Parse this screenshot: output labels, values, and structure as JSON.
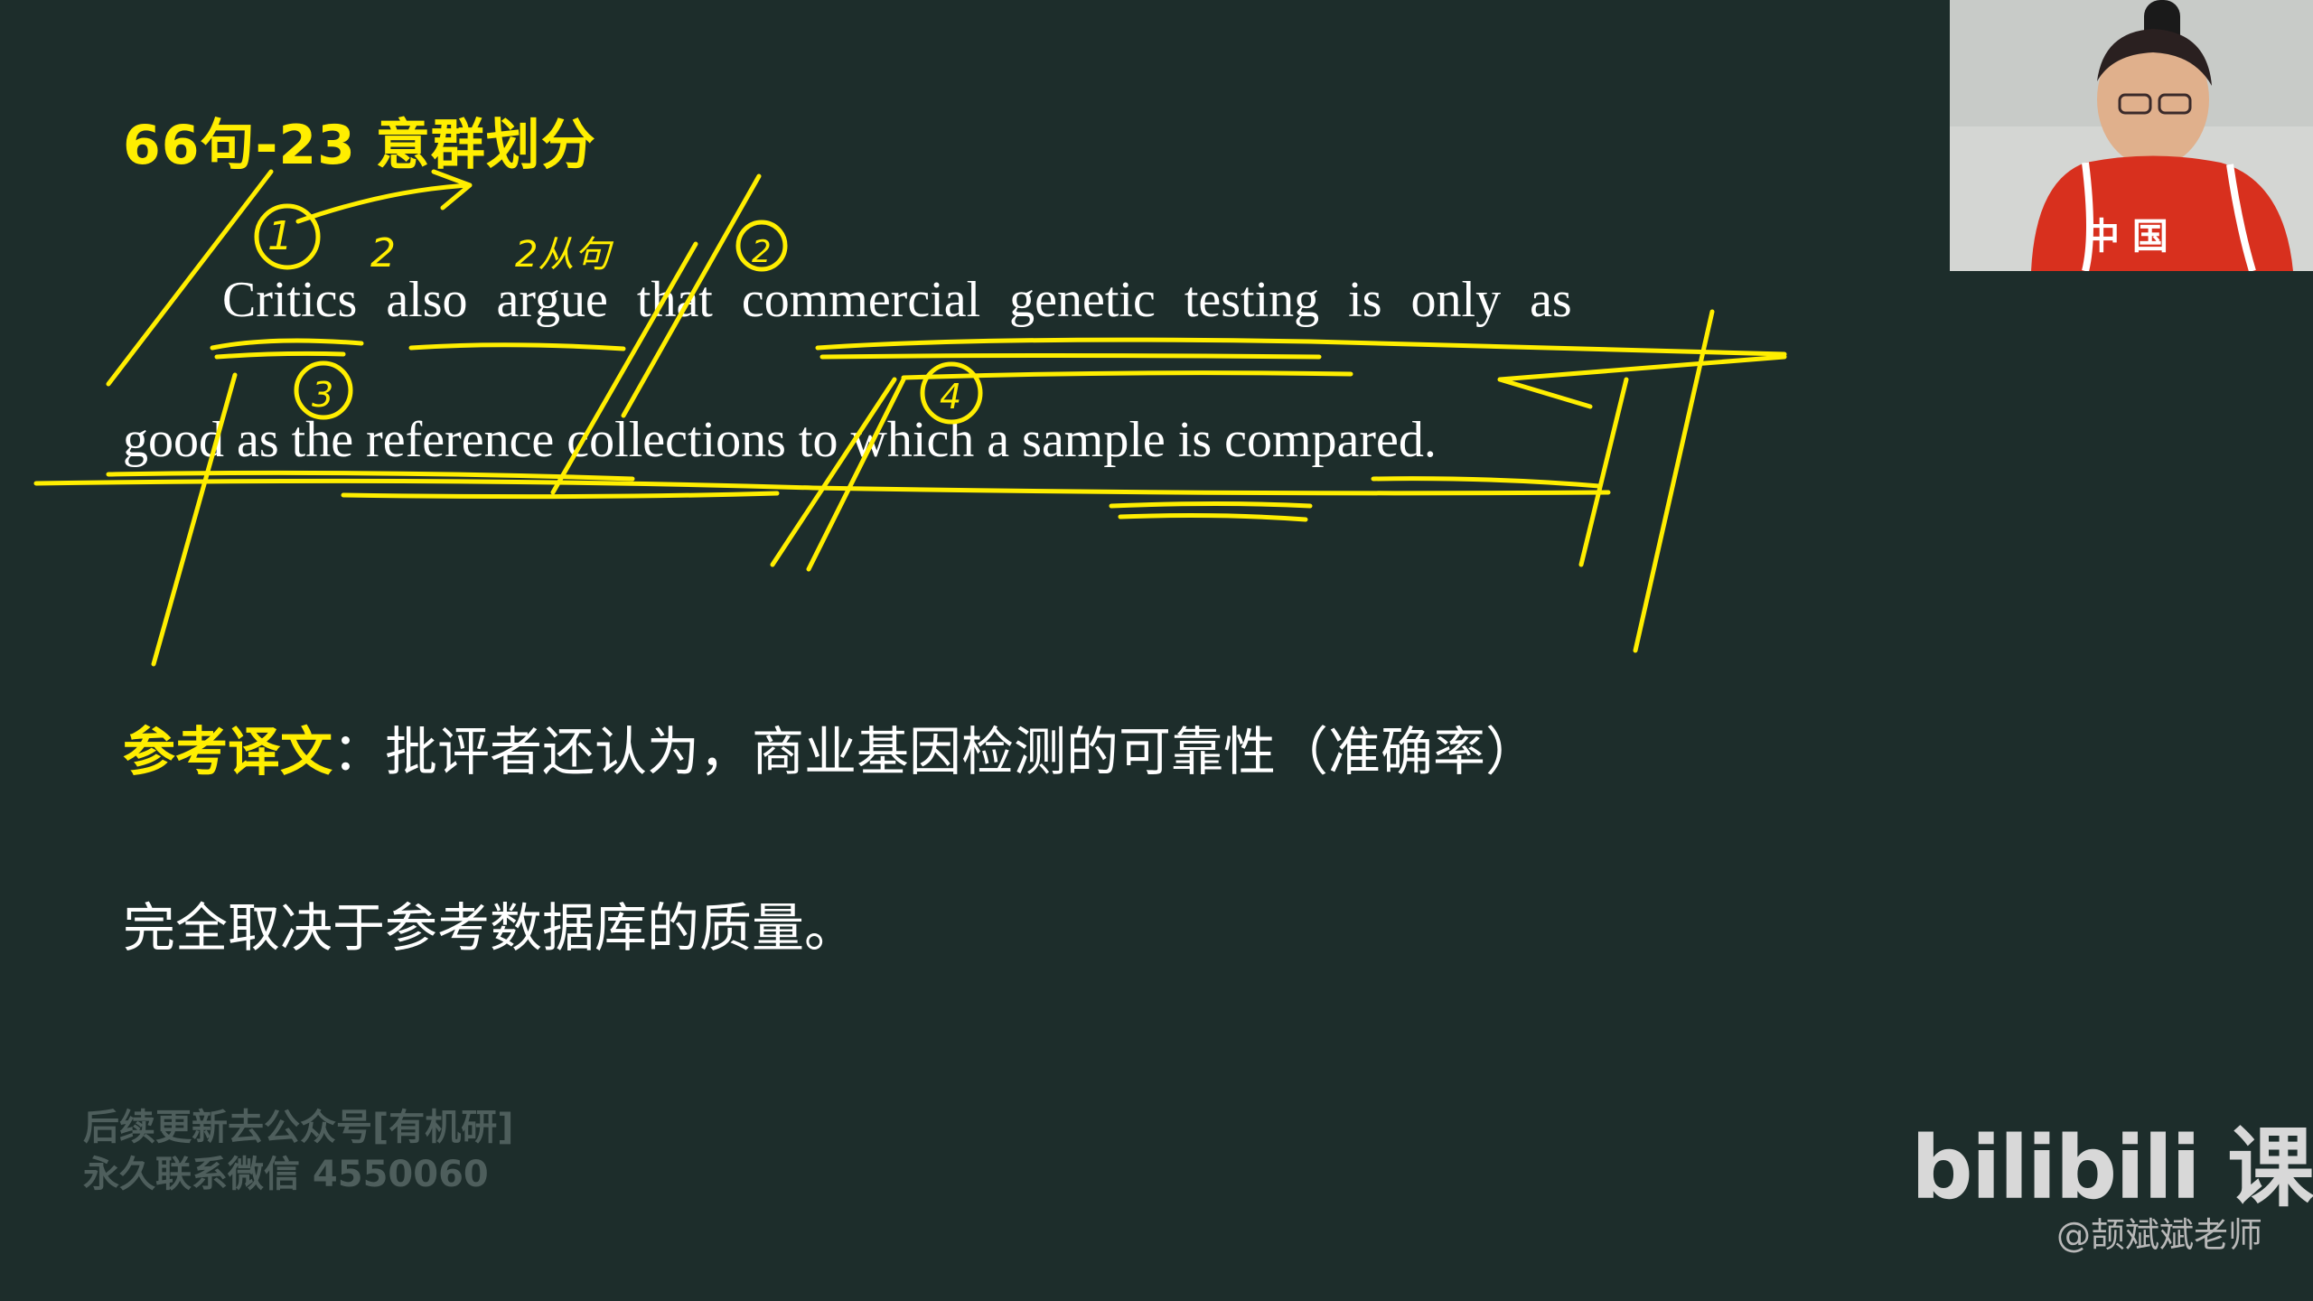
{
  "slide": {
    "title": "66句-23 意群划分",
    "sentence": {
      "line1": "Critics also argue that commercial genetic testing is only as",
      "line2": "good as the reference collections to which a sample is compared."
    },
    "translation": {
      "label": "参考译文",
      "separator": "：",
      "line1": "批评者还认为，商业基因检测的可靠性（准确率）",
      "line2": "完全取决于参考数据库的质量。"
    },
    "annotations": {
      "color": "#ffee00",
      "marks": [
        "①",
        "2",
        "2从句",
        "②",
        "③",
        "④",
        "3"
      ]
    }
  },
  "watermark": {
    "line1": "后续更新去公众号[有机研]",
    "line2": "永久联系微信 4550060"
  },
  "webcam": {
    "shirt_text": "中 国"
  },
  "brand": {
    "logo": "bilibili 课堂",
    "handle": "@颉斌斌老师"
  }
}
